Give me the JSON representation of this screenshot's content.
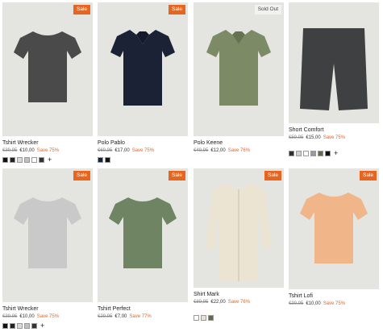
{
  "products": [
    {
      "name": "Tshirt Wrecker",
      "old_price": "€39,95",
      "price": "€10,00",
      "save": "Save 75%",
      "badge": "Sale",
      "shirt_color": "#4a4a4a",
      "swatches": [
        "#111111",
        "#222222",
        "#d9d9d9",
        "#bfbfbf",
        "#ffffff",
        "#333333"
      ],
      "more": "+"
    },
    {
      "name": "Polo Pablo",
      "old_price": "€69,95",
      "price": "€17,00",
      "save": "Save 75%",
      "badge": "Sale",
      "shirt_color": "#1c2236",
      "swatches": [
        "#1c2236",
        "#111111"
      ],
      "more": ""
    },
    {
      "name": "Polo Keene",
      "old_price": "€49,95",
      "price": "€12,00",
      "save": "Save 76%",
      "badge": "Sold Out",
      "shirt_color": "#7c8a66",
      "swatches": [],
      "more": ""
    },
    {
      "name": "Short Comfort",
      "old_price": "€59,95",
      "price": "€15,00",
      "save": "Save 75%",
      "badge": "",
      "shirt_color": "#3f4042",
      "swatches": [
        "#2d2d2d",
        "#cfcfcf",
        "#ffffff",
        "#9a9a9a",
        "#5f6b4f",
        "#111111"
      ],
      "more": "+"
    },
    {
      "name": "Tshirt Wrecker",
      "old_price": "€39,95",
      "price": "€10,00",
      "save": "Save 75%",
      "badge": "Sale",
      "shirt_color": "#c9c9c9",
      "swatches": [
        "#111111",
        "#222222",
        "#d9d9d9",
        "#bfbfbf",
        "#333333"
      ],
      "more": "+"
    },
    {
      "name": "Tshirt Perfect",
      "old_price": "€29,95",
      "price": "€7,00",
      "save": "Save 77%",
      "badge": "Sale",
      "shirt_color": "#6f8462",
      "swatches": [],
      "more": ""
    },
    {
      "name": "Shirt Mark",
      "old_price": "€89,95",
      "price": "€22,00",
      "save": "Save 76%",
      "badge": "Sale",
      "shirt_color": "#ece4d3",
      "swatches": [
        "#ffffff",
        "#e8e2d5",
        "#5f6b4f"
      ],
      "more": ""
    },
    {
      "name": "Tshirt Lofi",
      "old_price": "€39,95",
      "price": "€10,00",
      "save": "Save 75%",
      "badge": "Sale",
      "shirt_color": "#f0b589",
      "swatches": [],
      "more": ""
    }
  ]
}
